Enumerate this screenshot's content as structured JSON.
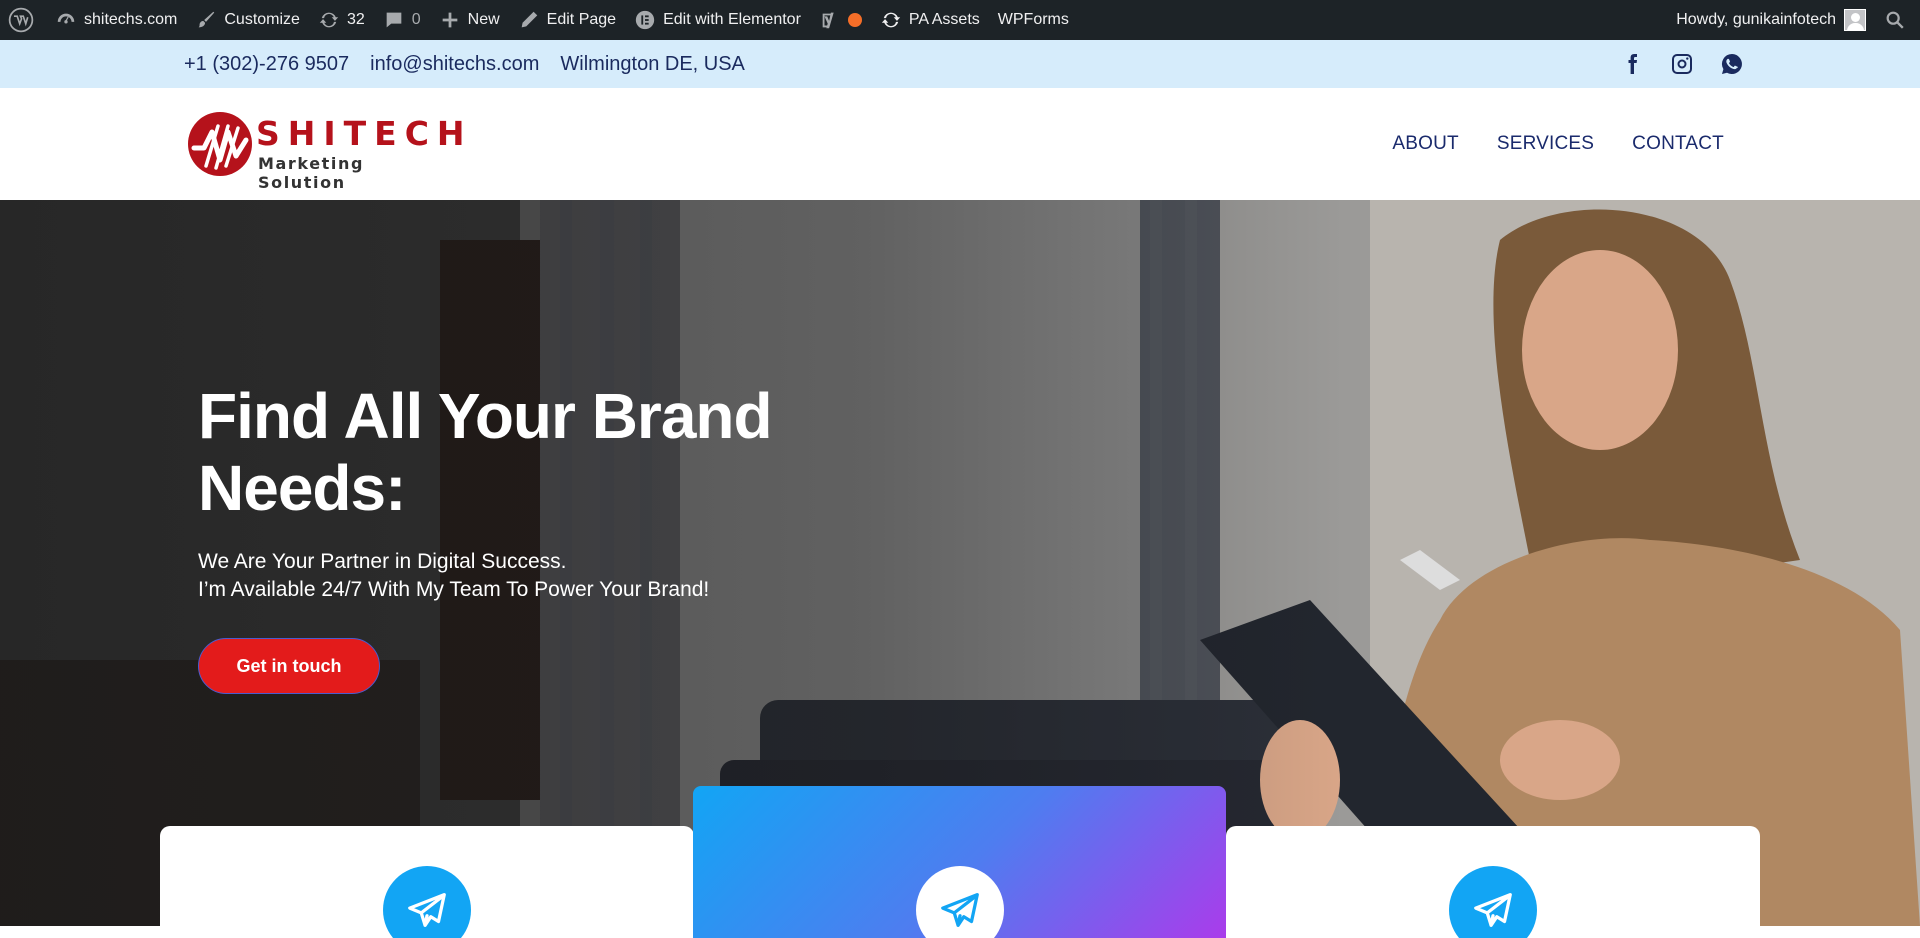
{
  "adminbar": {
    "site_name": "shitechs.com",
    "customize": "Customize",
    "updates_count": "32",
    "comments_count": "0",
    "new": "New",
    "edit_page": "Edit Page",
    "edit_elementor": "Edit with Elementor",
    "pa_assets": "PA Assets",
    "wpforms": "WPForms",
    "howdy": "Howdy, gunikainfotech"
  },
  "topbar": {
    "phone": "+1 (302)-276 9507",
    "email": "info@shitechs.com",
    "location": "Wilmington DE, USA",
    "social_icons": [
      "facebook-icon",
      "instagram-icon",
      "whatsapp-icon"
    ]
  },
  "header": {
    "logo": {
      "name": "SHITECH",
      "tagline": "Marketing Solution"
    },
    "nav": [
      "ABOUT",
      "SERVICES",
      "CONTACT"
    ]
  },
  "hero": {
    "title_line1": "Find All Your Brand",
    "title_line2": "Needs:",
    "subtitle_line1": "We Are Your Partner in Digital Success.",
    "subtitle_line2": "I’m Available 24/7 With My Team To Power Your Brand!",
    "cta": "Get in touch"
  },
  "features": {
    "icon": "paper-plane-icon",
    "colors": {
      "blue": "#12a5f4",
      "gradient_start": "#12a5f4",
      "gradient_end": "#b236ea"
    }
  },
  "colors": {
    "adminbar_bg": "#1d2327",
    "topbar_bg": "#d6ecfb",
    "nav_text": "#1a2a6c",
    "brand_red": "#b5121b",
    "cta_red": "#e31b1b"
  }
}
